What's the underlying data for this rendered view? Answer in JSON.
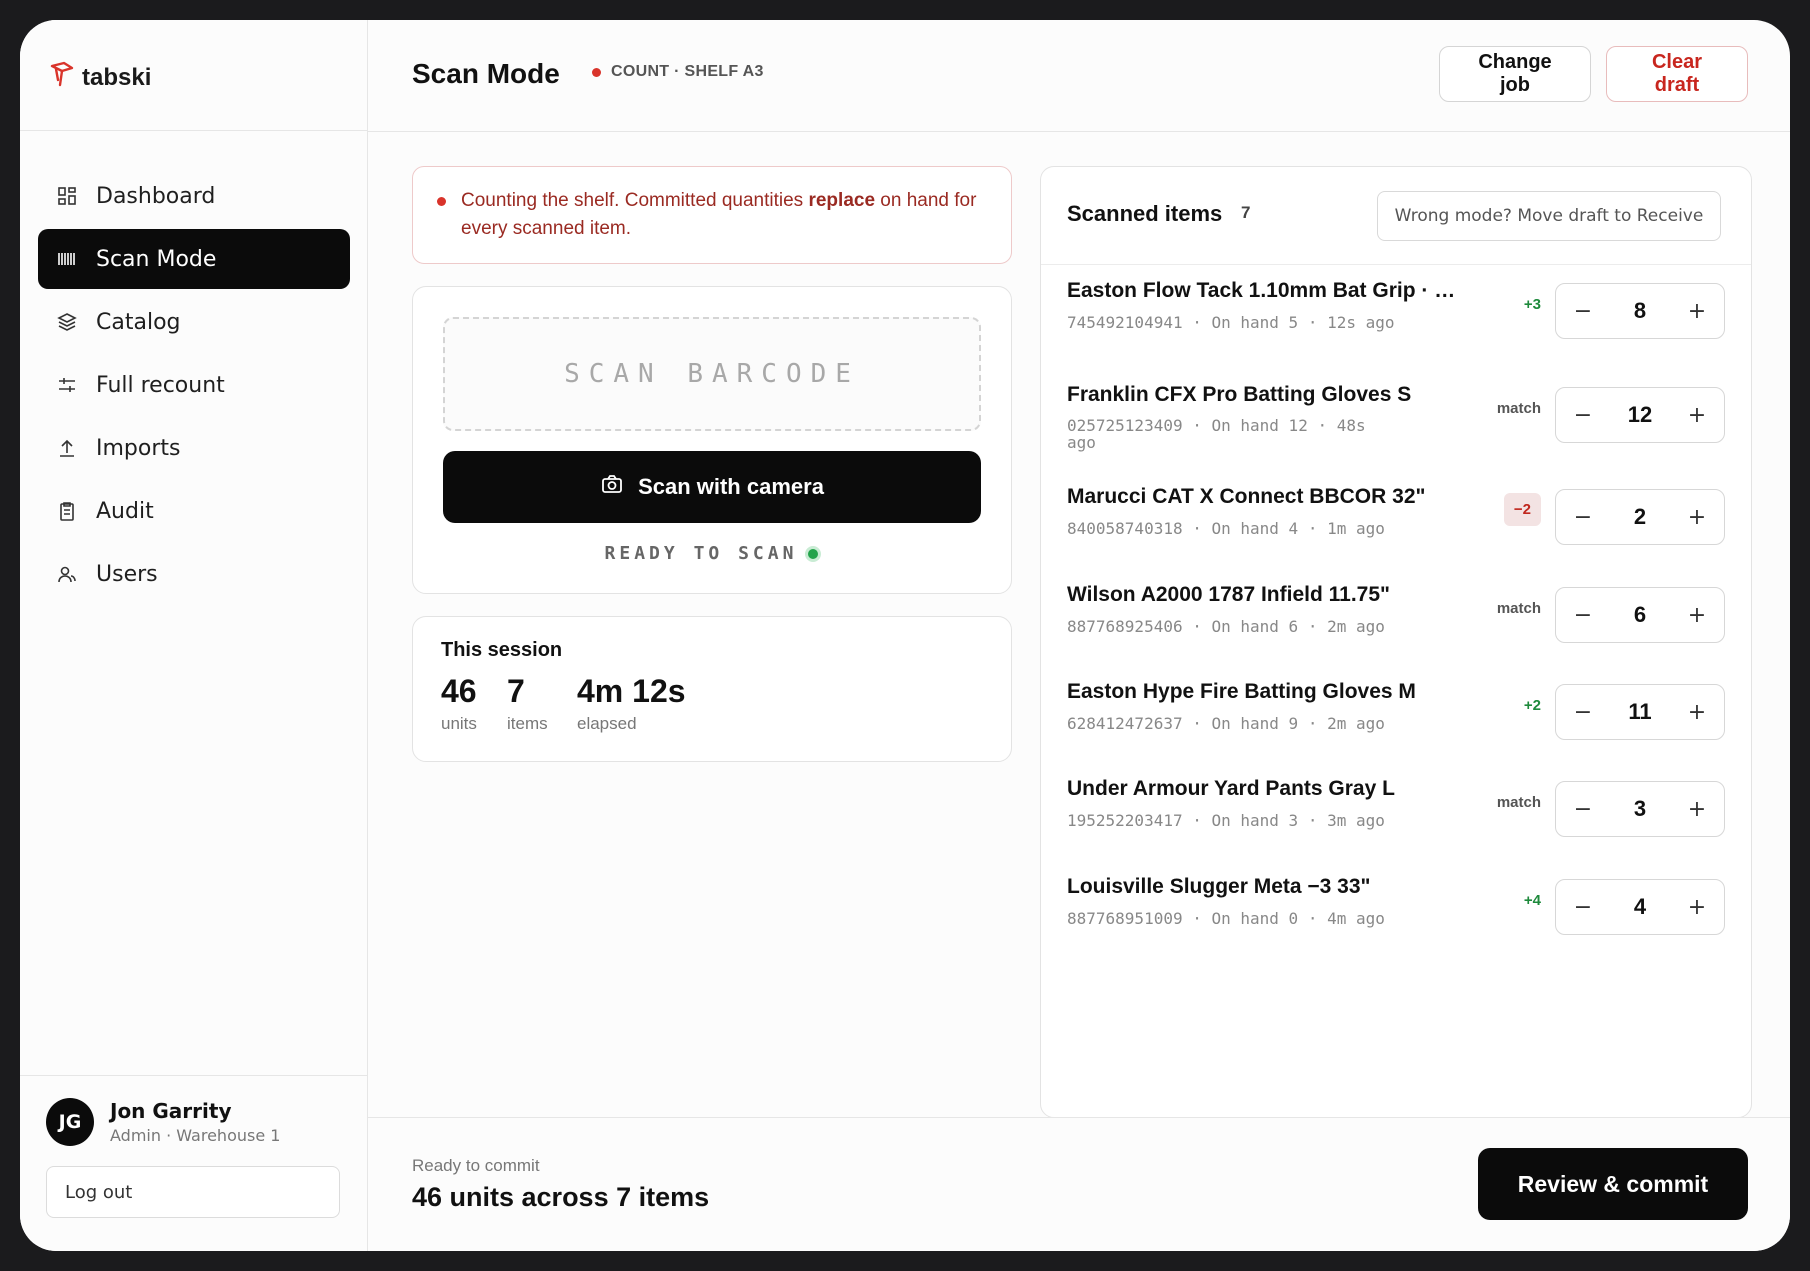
{
  "app": {
    "name": "tabski",
    "brand_color": "#d9342b"
  },
  "sidebar": {
    "items": [
      {
        "label": "Dashboard",
        "icon": "grid-icon",
        "active": false
      },
      {
        "label": "Scan Mode",
        "icon": "barcode-icon",
        "active": true
      },
      {
        "label": "Catalog",
        "icon": "layers-icon",
        "active": false
      },
      {
        "label": "Full recount",
        "icon": "sliders-icon",
        "active": false
      },
      {
        "label": "Imports",
        "icon": "upload-icon",
        "active": false
      },
      {
        "label": "Audit",
        "icon": "clipboard-icon",
        "active": false
      },
      {
        "label": "Users",
        "icon": "users-icon",
        "active": false
      }
    ],
    "user": {
      "initials": "JG",
      "name": "Jon Garrity",
      "role": "Admin · Warehouse 1"
    },
    "logout_label": "Log out"
  },
  "header": {
    "title": "Scan Mode",
    "mode": "COUNT · SHELF A3",
    "change_job_label": "Change job",
    "clear_draft_label": "Clear draft"
  },
  "notice": {
    "text_before": "Counting the shelf. Committed quantities ",
    "text_bold": "replace",
    "text_after": " on hand for every scanned item."
  },
  "scanner": {
    "placeholder": "SCAN BARCODE",
    "camera_label": "Scan with camera",
    "status": "READY TO SCAN"
  },
  "session": {
    "title": "This session",
    "units_value": "46",
    "units_label": "units",
    "items_value": "7",
    "items_label": "items",
    "elapsed_value": "4m 12s",
    "elapsed_label": "elapsed"
  },
  "scanned": {
    "title": "Scanned items",
    "count": "7",
    "move_label": "Wrong mode? Move draft to Receive",
    "items": [
      {
        "name": "Easton Flow Tack 1.10mm Bat Grip · …",
        "meta": "745492104941  ·  On hand 5  ·  12s ago",
        "delta": "+3",
        "delta_kind": "pos",
        "qty": "8"
      },
      {
        "name": "Franklin CFX Pro Batting Gloves S",
        "meta": "025725123409  ·  On hand 12  ·  48s ago",
        "delta": "match",
        "delta_kind": "match",
        "qty": "12"
      },
      {
        "name": "Marucci CAT X Connect BBCOR 32\"",
        "meta": "840058740318  ·  On hand 4  ·  1m ago",
        "delta": "−2",
        "delta_kind": "neg",
        "qty": "2"
      },
      {
        "name": "Wilson A2000 1787 Infield 11.75\"",
        "meta": "887768925406  ·  On hand 6  ·  2m ago",
        "delta": "match",
        "delta_kind": "match",
        "qty": "6"
      },
      {
        "name": "Easton Hype Fire Batting Gloves M",
        "meta": "628412472637  ·  On hand 9  ·  2m ago",
        "delta": "+2",
        "delta_kind": "pos",
        "qty": "11"
      },
      {
        "name": "Under Armour Yard Pants Gray L",
        "meta": "195252203417  ·  On hand 3  ·  3m ago",
        "delta": "match",
        "delta_kind": "match",
        "qty": "3"
      },
      {
        "name": "Louisville Slugger Meta −3 33\"",
        "meta": "887768951009  ·  On hand 0  ·  4m ago",
        "delta": "+4",
        "delta_kind": "pos",
        "qty": "4"
      }
    ],
    "minus_label": "−",
    "plus_label": "+"
  },
  "footer": {
    "label": "Ready to commit",
    "summary": "46 units across 7 items",
    "commit_label": "Review & commit"
  }
}
